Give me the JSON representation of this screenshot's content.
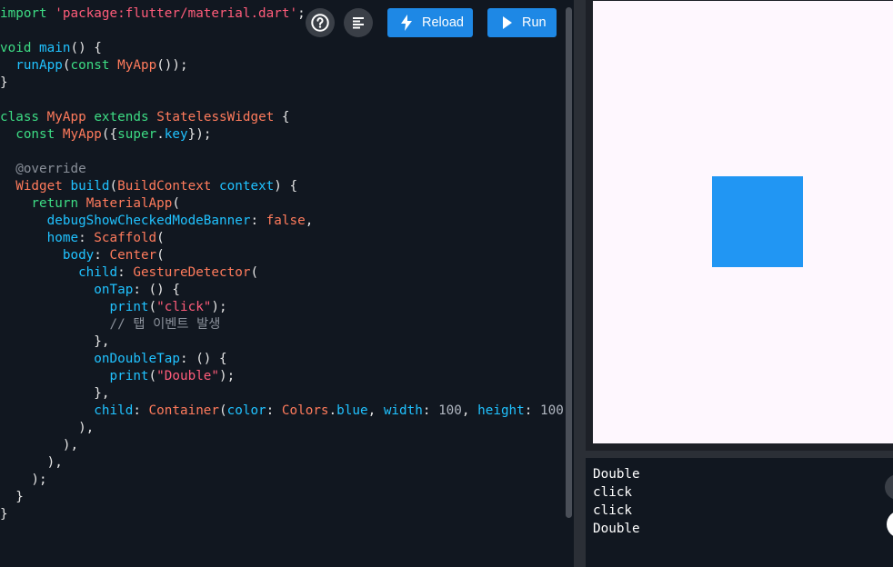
{
  "editor": {
    "lines": [
      [
        {
          "t": "import ",
          "c": "kw"
        },
        {
          "t": "'package:flutter/material.dart'",
          "c": "str"
        },
        {
          "t": ";",
          "c": "pl"
        }
      ],
      [],
      [
        {
          "t": "void ",
          "c": "kw"
        },
        {
          "t": "main",
          "c": "fn"
        },
        {
          "t": "() {",
          "c": "pl"
        }
      ],
      [
        {
          "t": "  runApp",
          "c": "fn"
        },
        {
          "t": "(",
          "c": "pl"
        },
        {
          "t": "const ",
          "c": "kw"
        },
        {
          "t": "MyApp",
          "c": "cls"
        },
        {
          "t": "());",
          "c": "pl"
        }
      ],
      [
        {
          "t": "}",
          "c": "pl"
        }
      ],
      [],
      [
        {
          "t": "class ",
          "c": "kw"
        },
        {
          "t": "MyApp ",
          "c": "cls"
        },
        {
          "t": "extends ",
          "c": "kw"
        },
        {
          "t": "StatelessWidget",
          "c": "cls"
        },
        {
          "t": " {",
          "c": "pl"
        }
      ],
      [
        {
          "t": "  const ",
          "c": "kw"
        },
        {
          "t": "MyApp",
          "c": "cls"
        },
        {
          "t": "({",
          "c": "pl"
        },
        {
          "t": "super",
          "c": "kw"
        },
        {
          "t": ".",
          "c": "pl"
        },
        {
          "t": "key",
          "c": "fn"
        },
        {
          "t": "});",
          "c": "pl"
        }
      ],
      [],
      [
        {
          "t": "  @override",
          "c": "cmt"
        }
      ],
      [
        {
          "t": "  Widget ",
          "c": "cls"
        },
        {
          "t": "build",
          "c": "fn"
        },
        {
          "t": "(",
          "c": "pl"
        },
        {
          "t": "BuildContext ",
          "c": "cls"
        },
        {
          "t": "context",
          "c": "fn"
        },
        {
          "t": ") {",
          "c": "pl"
        }
      ],
      [
        {
          "t": "    return ",
          "c": "kw"
        },
        {
          "t": "MaterialApp",
          "c": "cls"
        },
        {
          "t": "(",
          "c": "pl"
        }
      ],
      [
        {
          "t": "      debugShowCheckedModeBanner",
          "c": "fn"
        },
        {
          "t": ": ",
          "c": "pl"
        },
        {
          "t": "false",
          "c": "bool"
        },
        {
          "t": ",",
          "c": "pl"
        }
      ],
      [
        {
          "t": "      home",
          "c": "fn"
        },
        {
          "t": ": ",
          "c": "pl"
        },
        {
          "t": "Scaffold",
          "c": "cls"
        },
        {
          "t": "(",
          "c": "pl"
        }
      ],
      [
        {
          "t": "        body",
          "c": "fn"
        },
        {
          "t": ": ",
          "c": "pl"
        },
        {
          "t": "Center",
          "c": "cls"
        },
        {
          "t": "(",
          "c": "pl"
        }
      ],
      [
        {
          "t": "          child",
          "c": "fn"
        },
        {
          "t": ": ",
          "c": "pl"
        },
        {
          "t": "GestureDetector",
          "c": "cls"
        },
        {
          "t": "(",
          "c": "pl"
        }
      ],
      [
        {
          "t": "            onTap",
          "c": "fn"
        },
        {
          "t": ": () {",
          "c": "pl"
        }
      ],
      [
        {
          "t": "              print",
          "c": "fn"
        },
        {
          "t": "(",
          "c": "pl"
        },
        {
          "t": "\"click\"",
          "c": "str"
        },
        {
          "t": ");",
          "c": "pl"
        }
      ],
      [
        {
          "t": "              // 탭 이벤트 발생",
          "c": "cmt"
        }
      ],
      [
        {
          "t": "            },",
          "c": "pl"
        }
      ],
      [
        {
          "t": "            onDoubleTap",
          "c": "fn"
        },
        {
          "t": ": () {",
          "c": "pl"
        }
      ],
      [
        {
          "t": "              print",
          "c": "fn"
        },
        {
          "t": "(",
          "c": "pl"
        },
        {
          "t": "\"Double\"",
          "c": "str"
        },
        {
          "t": ");",
          "c": "pl"
        }
      ],
      [
        {
          "t": "            },",
          "c": "pl"
        }
      ],
      [
        {
          "t": "            child",
          "c": "fn"
        },
        {
          "t": ": ",
          "c": "pl"
        },
        {
          "t": "Container",
          "c": "cls"
        },
        {
          "t": "(",
          "c": "pl"
        },
        {
          "t": "color",
          "c": "fn"
        },
        {
          "t": ": ",
          "c": "pl"
        },
        {
          "t": "Colors",
          "c": "cls"
        },
        {
          "t": ".",
          "c": "pl"
        },
        {
          "t": "blue",
          "c": "fn"
        },
        {
          "t": ", ",
          "c": "pl"
        },
        {
          "t": "width",
          "c": "fn"
        },
        {
          "t": ": ",
          "c": "pl"
        },
        {
          "t": "100",
          "c": "num"
        },
        {
          "t": ", ",
          "c": "pl"
        },
        {
          "t": "height",
          "c": "fn"
        },
        {
          "t": ": ",
          "c": "pl"
        },
        {
          "t": "100",
          "c": "num"
        },
        {
          "t": "),",
          "c": "pl"
        }
      ],
      [
        {
          "t": "          ),",
          "c": "pl"
        }
      ],
      [
        {
          "t": "        ),",
          "c": "pl"
        }
      ],
      [
        {
          "t": "      ),",
          "c": "pl"
        }
      ],
      [
        {
          "t": "    );",
          "c": "pl"
        }
      ],
      [
        {
          "t": "  }",
          "c": "pl"
        }
      ],
      [
        {
          "t": "}",
          "c": "pl"
        }
      ]
    ]
  },
  "toolbar": {
    "help_icon": "help-circle-icon",
    "format_icon": "format-align-icon",
    "reload_label": "Reload",
    "reload_icon": "lightning-icon",
    "run_label": "Run",
    "run_icon": "play-icon"
  },
  "preview": {
    "background": "#fef7fe",
    "box_color": "#2196f3"
  },
  "console": {
    "lines": [
      "Double",
      "click",
      "click",
      "Double"
    ]
  },
  "colors": {
    "keyword": "#3ddc84",
    "class": "#ff7b5c",
    "identifier": "#20c2ff",
    "string": "#ff5c7a",
    "comment": "#8a909a",
    "button_blue": "#1e88e5"
  }
}
